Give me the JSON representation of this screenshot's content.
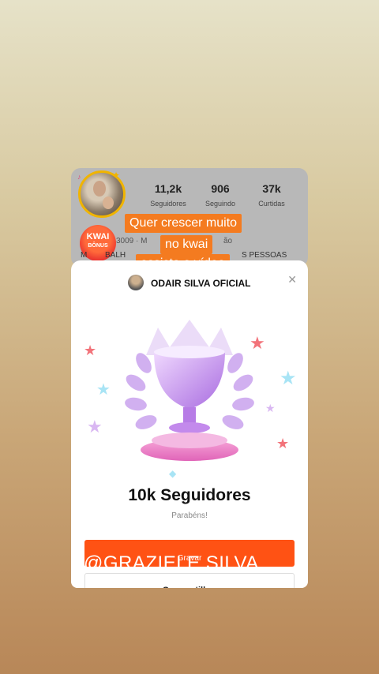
{
  "profile": {
    "stats": [
      {
        "value": "11,2k",
        "label": "Seguidores"
      },
      {
        "value": "906",
        "label": "Seguindo"
      },
      {
        "value": "37k",
        "label": "Curtidas"
      }
    ],
    "bonus_badge": {
      "line1": "KWAI",
      "line2": "BÔNUS"
    },
    "meta": "3009 · M",
    "meta_suffix": "ão",
    "bio_start": "M",
    "bio_mid": "BALH",
    "bio_end": "S PESSOAS"
  },
  "captions": {
    "line1": "Quer crescer muito",
    "line2": "no kwai",
    "line3": "assista o vídeo"
  },
  "modal": {
    "account_name": "ODAIR SILVA OFICIAL",
    "title": "10k Seguidores",
    "subtitle": "Parabéns!",
    "record_label": "Gravar",
    "share_label": "Compartilhar"
  },
  "watermark": "@GRAZIELE SILVA",
  "colors": {
    "accent": "#ff5214",
    "caption_bg": "#f47b20",
    "trophy": "#c98ee8"
  }
}
